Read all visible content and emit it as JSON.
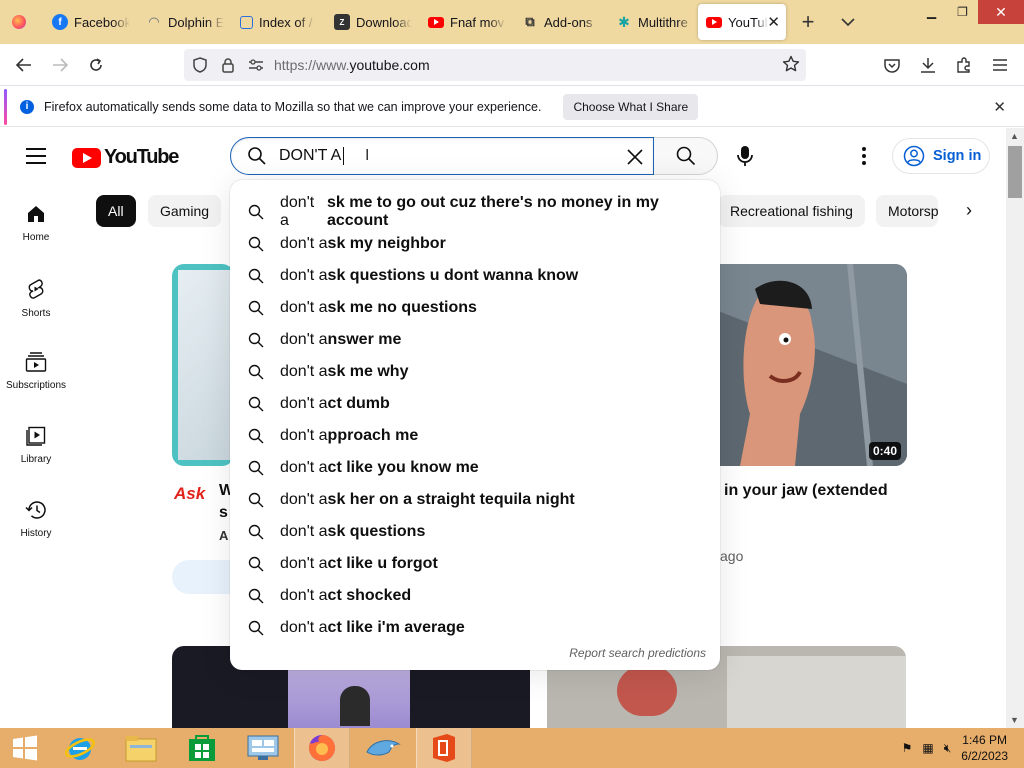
{
  "browser": {
    "tabs": [
      {
        "label": "Facebook",
        "favicon": "facebook-icon",
        "color": "#1877f2"
      },
      {
        "label": "Dolphin E",
        "favicon": "dolphin-icon",
        "color": "#5a6b7a"
      },
      {
        "label": "Index of /",
        "favicon": "folder-icon",
        "color": "#2a6fdb"
      },
      {
        "label": "Download",
        "favicon": "download-site-icon",
        "color": "#333333"
      },
      {
        "label": "Fnaf mov",
        "favicon": "youtube-icon",
        "color": "#ff0000"
      },
      {
        "label": "Add-ons",
        "favicon": "puzzle-icon",
        "color": "#333333"
      },
      {
        "label": "Multithre",
        "favicon": "multithreaded-icon",
        "color": "#1aa3a3"
      },
      {
        "label": "YouTub",
        "favicon": "youtube-icon",
        "color": "#ff0000",
        "active": true
      }
    ],
    "url": {
      "scheme": "https://www.",
      "host": "youtube.com"
    },
    "infobar": {
      "message": "Firefox automatically sends some data to Mozilla so that we can improve your experience.",
      "button": "Choose What I Share"
    }
  },
  "youtube": {
    "logo_text": "YouTube",
    "search_value": "DON'T A",
    "sign_in": "Sign in",
    "chips": [
      "All",
      "Gaming",
      "Recreational fishing",
      "Motorsp"
    ],
    "guide": [
      "Home",
      "Shorts",
      "Subscriptions",
      "Library",
      "History"
    ],
    "suggestions": [
      {
        "typed": "don't a",
        "rest": "sk me to go out cuz there's no money in my account"
      },
      {
        "typed": "don't a",
        "rest": "sk my neighbor"
      },
      {
        "typed": "don't a",
        "rest": "sk questions u dont wanna know"
      },
      {
        "typed": "don't a",
        "rest": "sk me no questions"
      },
      {
        "typed": "don't a",
        "rest": "nswer me"
      },
      {
        "typed": "don't a",
        "rest": "sk me why"
      },
      {
        "typed": "don't a",
        "rest": "ct dumb"
      },
      {
        "typed": "don't a",
        "rest": "pproach me"
      },
      {
        "typed": "don't a",
        "rest": "ct like you know me"
      },
      {
        "typed": "don't a",
        "rest": "sk her on a straight tequila night"
      },
      {
        "typed": "don't a",
        "rest": "sk questions"
      },
      {
        "typed": "don't a",
        "rest": "ct like u forgot"
      },
      {
        "typed": "don't a",
        "rest": "ct shocked"
      },
      {
        "typed": "don't a",
        "rest": "ct like i'm average"
      }
    ],
    "report_link": "Report search predictions",
    "videos": [
      {
        "title_partial": "W",
        "title_line2": "s",
        "meta_partial": "A",
        "channel_logo": "Ask"
      },
      {
        "title_partial": "in your jaw (extended",
        "meta_partial": "ago",
        "duration": "0:40"
      }
    ]
  },
  "taskbar": {
    "time": "1:46 PM",
    "date": "6/2/2023"
  },
  "colors": {
    "tabstrip": "#f0d9a0",
    "taskbar": "#e7ad6a",
    "youtube_red": "#ff0000",
    "link_blue": "#065fd4"
  }
}
